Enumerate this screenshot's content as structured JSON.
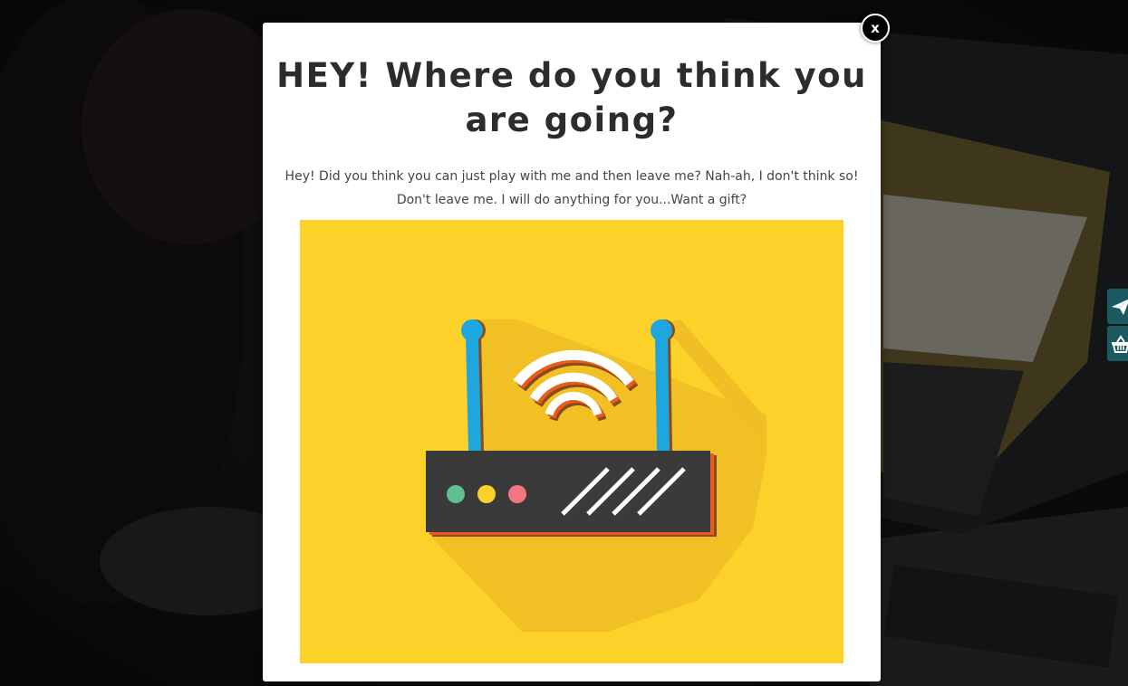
{
  "modal": {
    "title": "HEY! Where do you think you are going?",
    "message": "Hey! Did you think you can just play with me and then leave me? Nah-ah, I don't think so! Don't leave me. I will do anything for you...Want a gift?",
    "close_label": "x",
    "image_icon": "wifi-router-illustration"
  },
  "side_buttons": {
    "send_icon": "paper-plane-icon",
    "basket_icon": "shopping-basket-icon"
  },
  "colors": {
    "modal_background": "#ffffff",
    "title_text": "#2c2c2c",
    "illustration_background": "#fcd12a",
    "router_body": "#3a3a3a",
    "antenna": "#1ea7df",
    "side_button": "#1c5a62",
    "close_button": "#000000"
  }
}
